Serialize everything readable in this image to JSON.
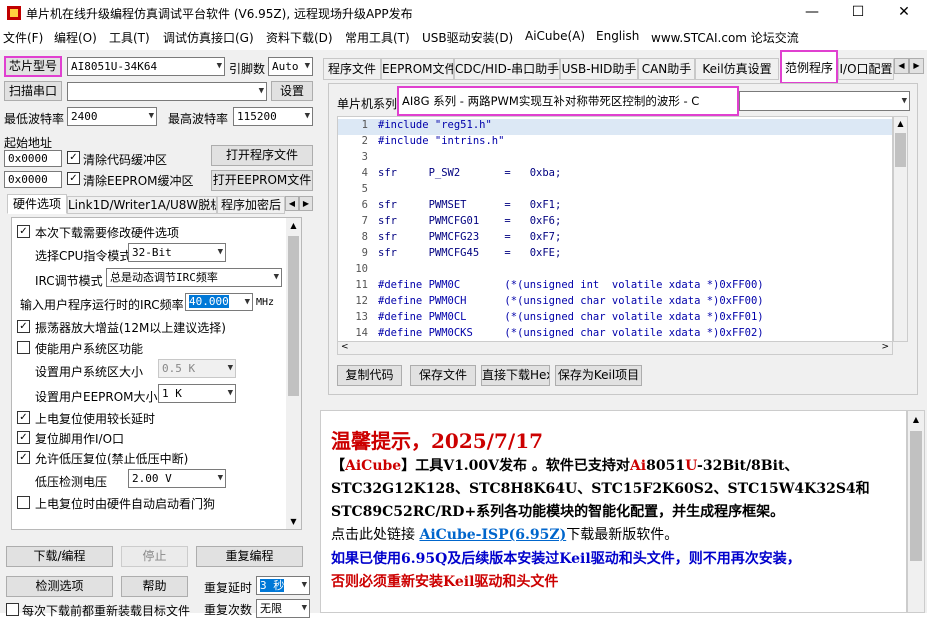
{
  "window": {
    "title": "单片机在线升级编程仿真调试平台软件 (V6.95Z), 远程现场升级APP发布",
    "minimize": "—",
    "maximize": "☐",
    "close": "✕"
  },
  "menu": [
    "文件(F)",
    "编程(O)",
    "工具(T)",
    "调试仿真接口(G)",
    "资料下载(D)",
    "常用工具(T)",
    "USB驱动安装(D)",
    "AiCube(A)",
    "English",
    "www.STCAI.com 论坛交流"
  ],
  "left": {
    "chip_label": "芯片型号",
    "chip_value": "AI8051U-34K64",
    "pin_label": "引脚数",
    "pin_value": "Auto",
    "scan_port": "扫描串口",
    "port_value": "",
    "settings_btn": "设置",
    "min_baud_label": "最低波特率",
    "min_baud_value": "2400",
    "max_baud_label": "最高波特率",
    "max_baud_value": "115200",
    "start_addr_label": "起始地址",
    "addr1": "0x0000",
    "clear_code": "清除代码缓冲区",
    "open_prog": "打开程序文件",
    "addr2": "0x0000",
    "clear_eeprom": "清除EEPROM缓冲区",
    "open_eeprom": "打开EEPROM文件",
    "tabs": [
      "硬件选项",
      "Link1D/Writer1A/U8W脱机",
      "程序加密后"
    ],
    "hw": {
      "modify_hw": "本次下载需要修改硬件选项",
      "cpu_mode_label": "选择CPU指令模式",
      "cpu_mode_value": "32-Bit",
      "irc_mode_label": "IRC调节模式",
      "irc_mode_value": "总是动态调节IRC频率",
      "irc_freq_label": "输入用户程序运行时的IRC频率",
      "irc_freq_value": "40.000",
      "irc_unit": "MHz",
      "osc_gain": "振荡器放大增益(12M以上建议选择)",
      "user_sys": "使能用户系统区功能",
      "sys_size_label": "设置用户系统区大小",
      "sys_size_value": "0.5 K",
      "eeprom_size_label": "设置用户EEPROM大小",
      "eeprom_size_value": "1  K",
      "long_delay": "上电复位使用较长延时",
      "reset_io": "复位脚用作I/O口",
      "lvd_reset": "允许低压复位(禁止低压中断)",
      "lvd_label": "低压检测电压",
      "lvd_value": "2.00 V",
      "watchdog": "上电复位时由硬件自动启动看门狗"
    },
    "download_btn": "下载/编程",
    "stop_btn": "停止",
    "reprogram_btn": "重复编程",
    "detect_btn": "检测选项",
    "help_btn": "帮助",
    "repeat_delay_label": "重复延时",
    "repeat_delay_value": "3 秒",
    "repeat_count_label": "重复次数",
    "repeat_count_value": "无限",
    "bottom_text": "每次下载前都重新装载目标文件"
  },
  "right": {
    "tabs": [
      "程序文件",
      "EEPROM文件",
      "CDC/HID-串口助手",
      "USB-HID助手",
      "CAN助手",
      "Keil仿真设置",
      "范例程序",
      "I/O口配置"
    ],
    "series_label": "单片机系列",
    "series_value": "AI8G 系列 - 两路PWM实现互补对称带死区控制的波形 - C",
    "code_lines": [
      {
        "n": "1",
        "t": "#include \"reg51.h\""
      },
      {
        "n": "2",
        "t": "#include \"intrins.h\""
      },
      {
        "n": "3",
        "t": ""
      },
      {
        "n": "4",
        "t": "sfr     P_SW2       =   0xba;"
      },
      {
        "n": "5",
        "t": ""
      },
      {
        "n": "6",
        "t": "sfr     PWMSET      =   0xF1;"
      },
      {
        "n": "7",
        "t": "sfr     PWMCFG01    =   0xF6;"
      },
      {
        "n": "8",
        "t": "sfr     PWMCFG23    =   0xF7;"
      },
      {
        "n": "9",
        "t": "sfr     PWMCFG45    =   0xFE;"
      },
      {
        "n": "10",
        "t": ""
      },
      {
        "n": "11",
        "t": "#define PWM0C       (*(unsigned int  volatile xdata *)0xFF00)"
      },
      {
        "n": "12",
        "t": "#define PWM0CH      (*(unsigned char volatile xdata *)0xFF00)"
      },
      {
        "n": "13",
        "t": "#define PWM0CL      (*(unsigned char volatile xdata *)0xFF01)"
      },
      {
        "n": "14",
        "t": "#define PWM0CKS     (*(unsigned char volatile xdata *)0xFF02)"
      }
    ],
    "copy_code": "复制代码",
    "save_file": "保存文件",
    "direct_download": "直接下载Hex",
    "save_keil": "保存为Keil项目",
    "notice": {
      "title": "温馨提示，2025/7/17",
      "l1_a": "【",
      "l1_b": "AiCube",
      "l1_c": "】工具V1.00V发布 。软件已支持对",
      "l1_d": "Ai",
      "l1_e": "8051",
      "l1_f": "U",
      "l1_g": "-32Bit/8Bit、",
      "l2": "STC32G12K128、STC8H8K64U、STC15F2K60S2、STC15W4K32S4和",
      "l3": "STC89C52RC/RD+系列各功能模块的智能化配置，并生成程序框架。",
      "l4_a": "点击此处链接 ",
      "l4_b": "AiCube-ISP(6.95Z)",
      "l4_c": "下载最新版软件。",
      "l5": "如果已使用6.95Q及后续版本安装过Keil驱动和头文件，则不用再次安装，",
      "l6": "否则必须重新安装Keil驱动和头文件"
    }
  }
}
